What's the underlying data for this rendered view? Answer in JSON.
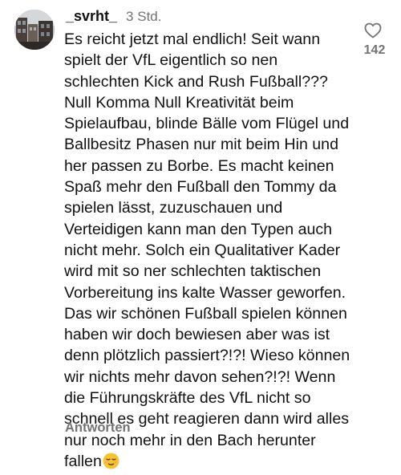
{
  "comment": {
    "username": "_svrht_",
    "timestamp": "3 Std.",
    "text_lines": [
      "Es reicht jetzt mal endlich! Seit wann",
      "spielt der VfL eigentlich so nen",
      "schlechten Kick and Rush Fußball???",
      "Null Komma Null Kreativität beim",
      "Spielaufbau, blinde Bälle vom Flügel und",
      "Ballbesitz Phasen nur mit beim Hin und",
      "her passen zu Borbe. Es macht keinen",
      "Spaß mehr den Fußball den Tommy da",
      "spielen lässt, zuzuschauen und",
      "Verteidigen kann man den Typen auch",
      "nicht mehr. Solch ein Qualitativer Kader",
      "wird mit so ner schlechten taktischen",
      "Vorbereitung ins kalte Wasser geworfen.",
      "Das wir schönen Fußball spielen können",
      "haben wir doch bewiesen aber was ist",
      "denn plötzlich passiert?!?! Wieso können",
      "wir nichts mehr davon sehen?!?! Wenn",
      "die Führungskräfte des VfL nicht so",
      "schnell es geht reagieren dann wird alles",
      "nur noch mehr in den Bach herunter"
    ],
    "last_line": "fallen",
    "trailing_emoji": "relieved-face-emoji",
    "like_icon": "heart-outline-icon",
    "like_count": "142",
    "reply_label": "Antworten",
    "colors": {
      "text": "#111111",
      "secondary": "#737373",
      "emoji_face": "#f7c233"
    }
  }
}
